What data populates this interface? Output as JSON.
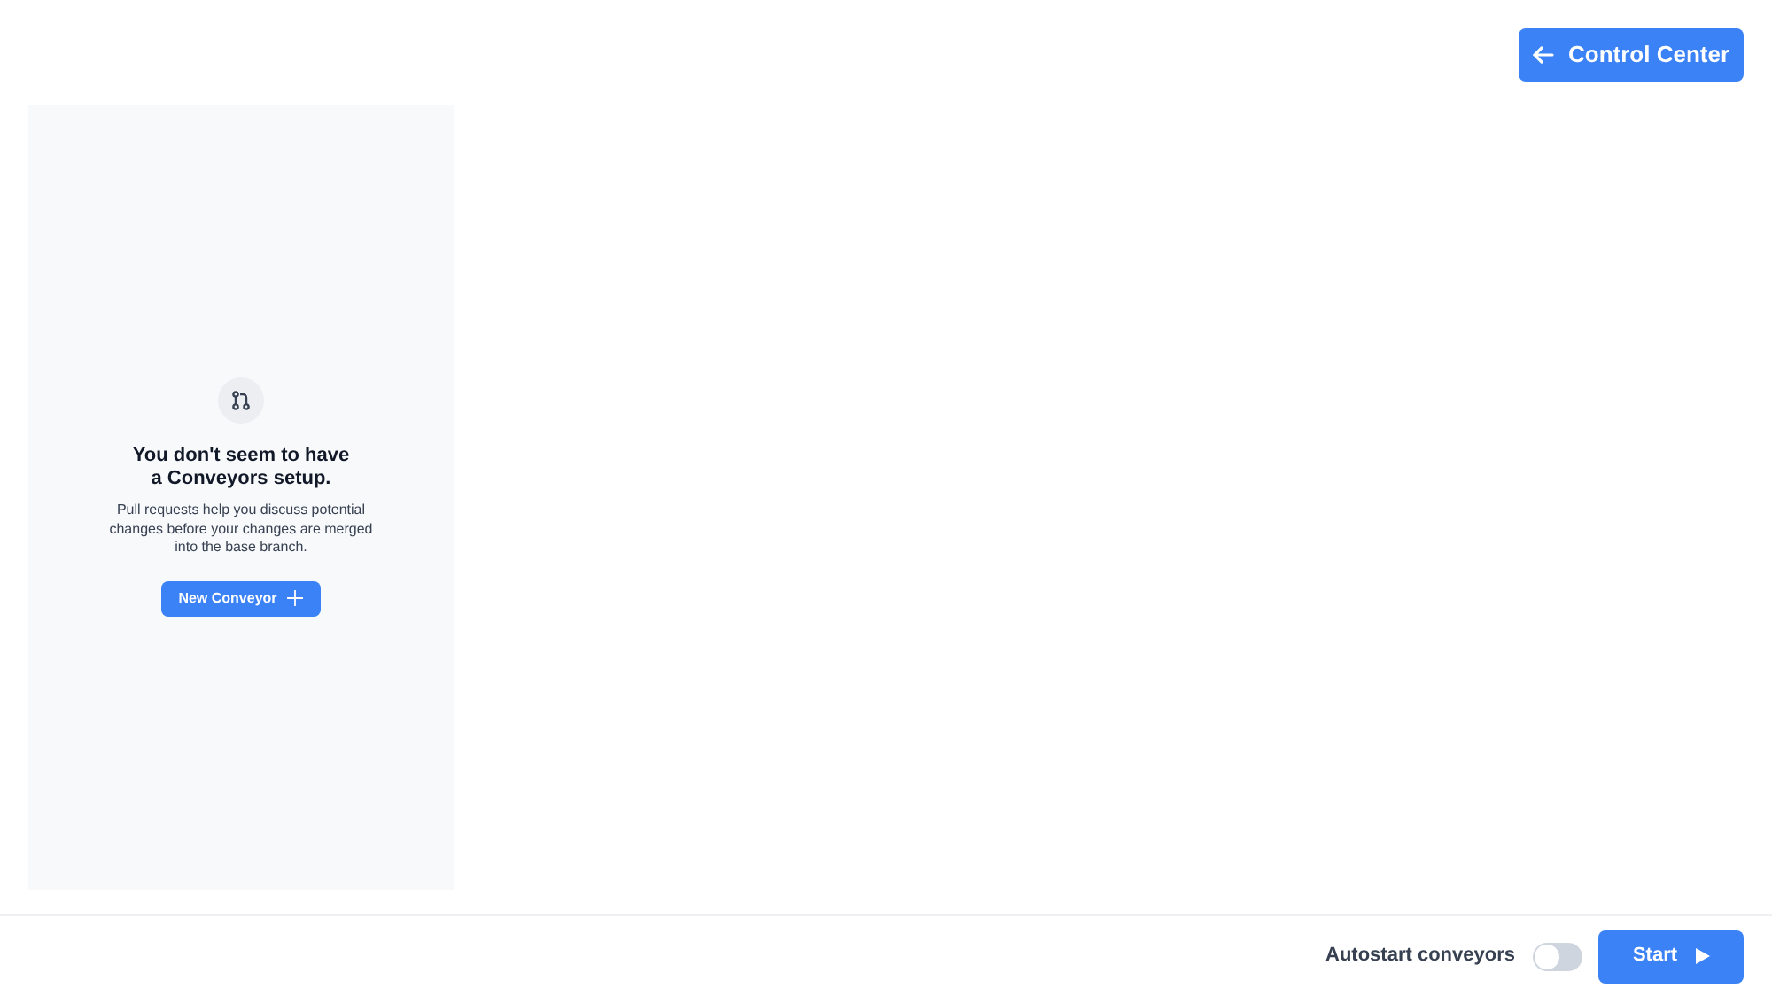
{
  "header": {
    "back_button": "Control Center"
  },
  "empty_state": {
    "title": "You don't seem to have a Conveyors setup.",
    "description": "Pull requests help you discuss potential changes before your changes are merged into the base branch.",
    "button": "New Conveyor"
  },
  "footer": {
    "autostart": {
      "label": "Autostart conveyors",
      "on": false
    },
    "start_button": "Start"
  }
}
